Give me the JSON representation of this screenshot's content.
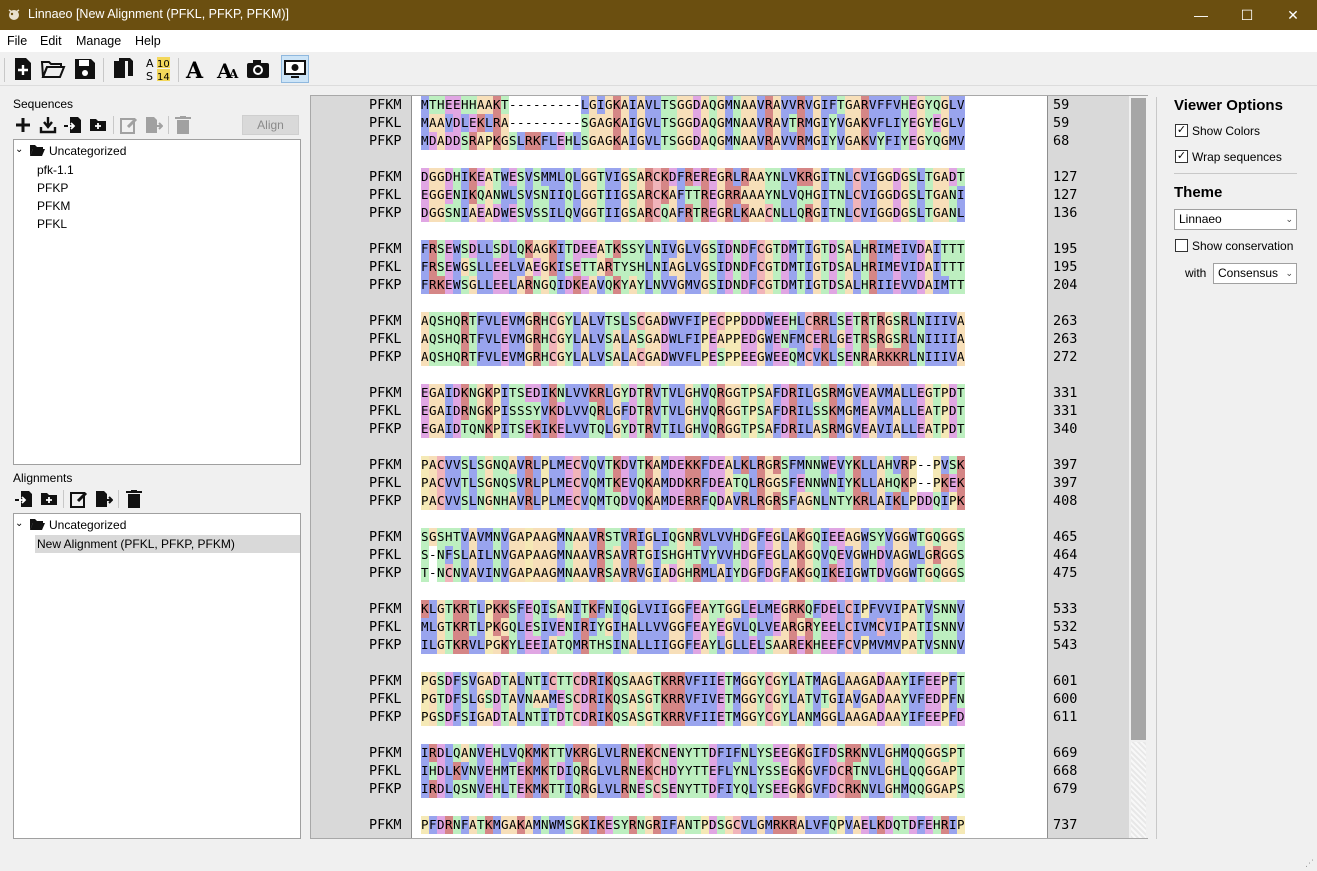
{
  "window": {
    "title": "Linnaeo [New Alignment (PFKL, PFKP, PFKM)]",
    "minimize": "—",
    "maximize": "☐",
    "close": "✕"
  },
  "menu": [
    "File",
    "Edit",
    "Manage",
    "Help"
  ],
  "toolbar": {
    "icons": [
      "new-file-icon",
      "open-folder-icon",
      "save-icon",
      "copy-icon",
      "residue-numbering-icon",
      "font-icon",
      "font-size-icon",
      "screenshot-icon",
      "viewer-icon"
    ]
  },
  "sequences": {
    "label": "Sequences",
    "align_button": "Align",
    "folder": "Uncategorized",
    "items": [
      "pfk-1.1",
      "PFKP",
      "PFKM",
      "PFKL"
    ]
  },
  "alignments": {
    "label": "Alignments",
    "folder": "Uncategorized",
    "items": [
      "New Alignment (PFKL, PFKP, PFKM)"
    ]
  },
  "viewer_options": {
    "title": "Viewer Options",
    "show_colors": "Show Colors",
    "wrap_sequences": "Wrap sequences",
    "theme_title": "Theme",
    "theme_value": "Linnaeo",
    "show_conservation": "Show conservation",
    "with_label": "with",
    "with_value": "Consensus",
    "show_colors_checked": true,
    "wrap_checked": true,
    "conservation_checked": false
  },
  "colors": {
    "titlebar": "#6b4f10",
    "A": "#f7dfb9",
    "G": "#f7dfb9",
    "I": "#99a4ee",
    "L": "#99a4ee",
    "V": "#99a4ee",
    "M": "#99a4ee",
    "F": "#99a4ee",
    "W": "#99a4ee",
    "C": "#f1b4ba",
    "S": "#bdefc0",
    "T": "#bdefc0",
    "N": "#bdefc0",
    "Q": "#bdefc0",
    "Y": "#bdefc0",
    "H": "#bdefc0",
    "P": "#f5e9b6",
    "K": "#d58686",
    "R": "#d58686",
    "D": "#e0a6e3",
    "E": "#e0a6e3"
  },
  "alignment": {
    "blocks": [
      {
        "rows": [
          {
            "name": "PFKM",
            "seq": "MTHEEHHAAKT---------LGIGKAIAVLTSGGDAQGMNAAVRAVVRVGIFTGARVFFVHEGYQGLV",
            "end": "59"
          },
          {
            "name": "PFKL",
            "seq": "MAAVDLEKLRA---------SGAGKAIGVLTSGGDAQGMNAAVRAVTRMGIYVGAKVFLIYEGYEGLV",
            "end": "59"
          },
          {
            "name": "PFKP",
            "seq": "MDADDSRAPKGSLRKFLEHLSGAGKAIGVLTSGGDAQGMNAAVRAVVRMGIYVGAKVYFIYEGYQGMV",
            "end": "68"
          }
        ]
      },
      {
        "rows": [
          {
            "name": "PFKM",
            "seq": "DGGDHIKEATWESVSMMLQLGGTVIGSARCKDFREREGRLRAAYNLVKRGITNLCVIGGDGSLTGADT",
            "end": "127"
          },
          {
            "name": "PFKL",
            "seq": "EGGENIKQANWLSVSNIIQLGGTIIGSARCKAFTTREGRRAAAYNLVQHGITNLCVIGGDGSLTGANI",
            "end": "127"
          },
          {
            "name": "PFKP",
            "seq": "DGGSNIAEADWESVSSILQVGGTIIGSARCQAFRTREGRLKAACNLLQRGITNLCVIGGDGSLTGANL",
            "end": "136"
          }
        ]
      },
      {
        "rows": [
          {
            "name": "PFKM",
            "seq": "FRSEWSDLLSDLQKAGKITDEEATKSSYLNIVGLVGSIDNDFCGTDMTIGTDSALHRIMEIVDAITTT",
            "end": "195"
          },
          {
            "name": "PFKL",
            "seq": "FRSEWGSLLEELVAEGKISETTARTYSHLNIAGLVGSIDNDFCGTDMTIGTDSALHRIMEVIDAITTT",
            "end": "195"
          },
          {
            "name": "PFKP",
            "seq": "FRKEWSGLLEELARNGQIDKEAVQKYAYLNVVGMVGSIDNDFCGTDMTIGTDSALHRIIEVVDAIMTT",
            "end": "204"
          }
        ]
      },
      {
        "rows": [
          {
            "name": "PFKM",
            "seq": "AQSHQRTFVLEVMGRHCGYLALVTSLSCGADWVFIPECPPDDDWEEHLCRRLSETRTRGSRLNIIIVA",
            "end": "263"
          },
          {
            "name": "PFKL",
            "seq": "AQSHQRTFVLEVMGRHCGYLALVSALASGADWLFIPEAPPEDGWENFMCERLGETRSRGSRLNIIIIA",
            "end": "263"
          },
          {
            "name": "PFKP",
            "seq": "AQSHQRTFVLEVMGRHCGYLALVSALACGADWVFLPESPPEEGWEEQMCVKLSENRARKKRLNIIIVA",
            "end": "272"
          }
        ]
      },
      {
        "rows": [
          {
            "name": "PFKM",
            "seq": "EGAIDKNGKPITSEDIKNLVVKRLGYDTRVTVLGHVQRGGTPSAFDRILGSRMGVEAVMALLEGTPDT",
            "end": "331"
          },
          {
            "name": "PFKL",
            "seq": "EGAIDRNGKPISSSYVKDLVVQRLGFDTRVTVLGHVQRGGTPSAFDRILSSKMGMEAVMALLEATPDT",
            "end": "331"
          },
          {
            "name": "PFKP",
            "seq": "EGAIDTQNKPITSEKIKELVVTQLGYDTRVTILGHVQRGGTPSAFDRILASRMGVEAVIALLEATPDT",
            "end": "340"
          }
        ]
      },
      {
        "rows": [
          {
            "name": "PFKM",
            "seq": "PACVVSLSGNQAVRLPLMECVQVTKDVTKAMDEKKFDEALKLRGRSFMNNWEVYKLLAHVRP--PVSK",
            "end": "397"
          },
          {
            "name": "PFKL",
            "seq": "PACVVTLSGNQSVRLPLMECVQMTKEVQKAMDDKRFDEATQLRGGSFENNWNIYKLLAHQKP--PKEK",
            "end": "397"
          },
          {
            "name": "PFKP",
            "seq": "PACVVSLNGNHAVRLPLMECVQMTQDVQKAMDERRFQDAVRLRGRSFAGNLNTYKRLAIKLPDDQIPK",
            "end": "408"
          }
        ]
      },
      {
        "rows": [
          {
            "name": "PFKM",
            "seq": "SGSHTVAVMNVGAPAAGMNAAVRSTVRIGLIQGNRVLVVHDGFEGLAKGQIEEAGWSYVGGWTGQGGS",
            "end": "465"
          },
          {
            "name": "PFKL",
            "seq": "S-NFSLAILNVGAPAAGMNAAVRSAVRTGISHGHTVYVVHDGFEGLAKGQVQEVGWHDVAGWLGRGGS",
            "end": "464"
          },
          {
            "name": "PFKP",
            "seq": "T-NCNVAVINVGAPAAGMNAAVRSAVRVGIADGHRMLAIYDGFDGFAKGQIKEIGWTDVGGWTGQGGS",
            "end": "475"
          }
        ]
      },
      {
        "rows": [
          {
            "name": "PFKM",
            "seq": "KLGTKRTLPKKSFEQISANITKFNIQGLVIIGGFEAYTGGLELMEGRKQFDELCIPFVVIPATVSNNV",
            "end": "533"
          },
          {
            "name": "PFKL",
            "seq": "MLGTKRTLPKGQLESIVENIRIYGIHALLVVGGFEAYEGVLQLVEARGRYEELCIVMCVIPATISNNV",
            "end": "532"
          },
          {
            "name": "PFKP",
            "seq": "ILGTKRVLPGKYLEEIATQMRTHSINALLIIGGFEAYLGLLELSAAREKHEEFCVPMVMVPATVSNNV",
            "end": "543"
          }
        ]
      },
      {
        "rows": [
          {
            "name": "PFKM",
            "seq": "PGSDFSVGADTALNTICTTCDRIKQSAAGTKRRVFIIETMGGYCGYLATMAGLAAGADAAYIFEEPFT",
            "end": "601"
          },
          {
            "name": "PFKL",
            "seq": "PGTDFSLGSDTAVNAAMESCDRIKQSASGTKRRVFIVETMGGYCGYLATVTGIAVGADAAYVFEDPFN",
            "end": "600"
          },
          {
            "name": "PFKP",
            "seq": "PGSDFSIGADTALNTITDTCDRIKQSASGTKRRVFIIETMGGYCGYLANMGGLAAGADAAYIFEEPFD",
            "end": "611"
          }
        ]
      },
      {
        "rows": [
          {
            "name": "PFKM",
            "seq": "IRDLQANVEHLVQKMKTTVKRGLVLRNEKCNENYTTDFIFNLYSEEGKGIFDSRKNVLGHMQQGGSPT",
            "end": "669"
          },
          {
            "name": "PFKL",
            "seq": "IHDLKVNVEHMTEKMKTDIQRGLVLRNEKCHDYYTTEFLYNLYSSEGKGVFDCRTNVLGHLQQGGAPT",
            "end": "668"
          },
          {
            "name": "PFKP",
            "seq": "IRDLQSNVEHLTEKMKTTIQRGLVLRNESCSENYTTDFIYQLYSEEGKGVFDCRKNVLGHMQQGGAPS",
            "end": "679"
          }
        ]
      },
      {
        "rows": [
          {
            "name": "PFKM",
            "seq": "PFDRNFATKMGAKAMNWMSGKIKESYRNGRIFANTPDSGCVLGMRKRALVFQPVAELKDQTDFEHRIP",
            "end": "737"
          }
        ]
      }
    ]
  }
}
